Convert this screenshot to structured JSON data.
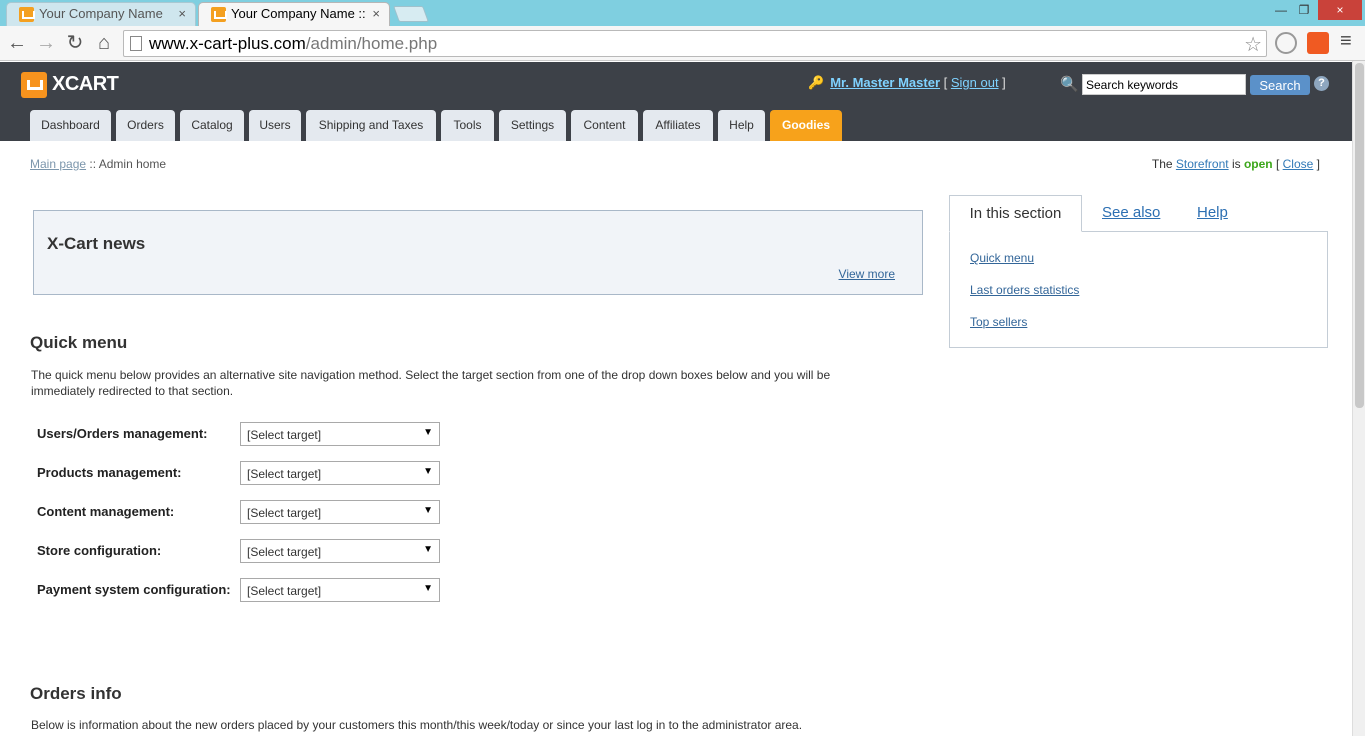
{
  "browser": {
    "tabs": [
      {
        "title": "Your Company Name",
        "active": false
      },
      {
        "title": "Your Company Name ::",
        "active": true
      }
    ],
    "url_host": "www.x-cart-plus.com",
    "url_path": "/admin/home.php",
    "close_glyph": "×"
  },
  "header": {
    "logo_text": "XCART",
    "user_name": "Mr. Master Master",
    "sign_out": "Sign out",
    "search_placeholder": "Search keywords",
    "search_button": "Search",
    "help_glyph": "?"
  },
  "nav": {
    "tabs": [
      "Dashboard",
      "Orders",
      "Catalog",
      "Users",
      "Shipping and Taxes",
      "Tools",
      "Settings",
      "Content",
      "Affiliates",
      "Help",
      "Goodies"
    ]
  },
  "breadcrumb": {
    "link": "Main page",
    "separator": " :: ",
    "current": "Admin home"
  },
  "storefront": {
    "prefix": "The ",
    "link": "Storefront",
    "is": " is ",
    "status": "open",
    "close": "Close"
  },
  "news": {
    "title": "X-Cart news",
    "view_more": "View more"
  },
  "side_panel": {
    "tabs": [
      "In this section",
      "See also",
      "Help"
    ],
    "links": [
      "Quick menu",
      "Last orders statistics",
      "Top sellers"
    ]
  },
  "quick_menu": {
    "title": "Quick menu",
    "description": "The quick menu below provides an alternative site navigation method. Select the target section from one of the drop down boxes below and you will be immediately redirected to that section.",
    "rows": [
      {
        "label": "Users/Orders management:",
        "value": "[Select target]"
      },
      {
        "label": "Products management:",
        "value": "[Select target]"
      },
      {
        "label": "Content management:",
        "value": "[Select target]"
      },
      {
        "label": "Store configuration:",
        "value": "[Select target]"
      },
      {
        "label": "Payment system configuration:",
        "value": "[Select target]"
      }
    ]
  },
  "orders_info": {
    "title": "Orders info",
    "description": "Below is information about the new orders placed by your customers this month/this week/today or since your last log in to the administrator area."
  },
  "colors": {
    "header_bg": "#3d4148",
    "accent": "#f7a21b",
    "link": "#336699",
    "open_status": "#3ca61a"
  }
}
